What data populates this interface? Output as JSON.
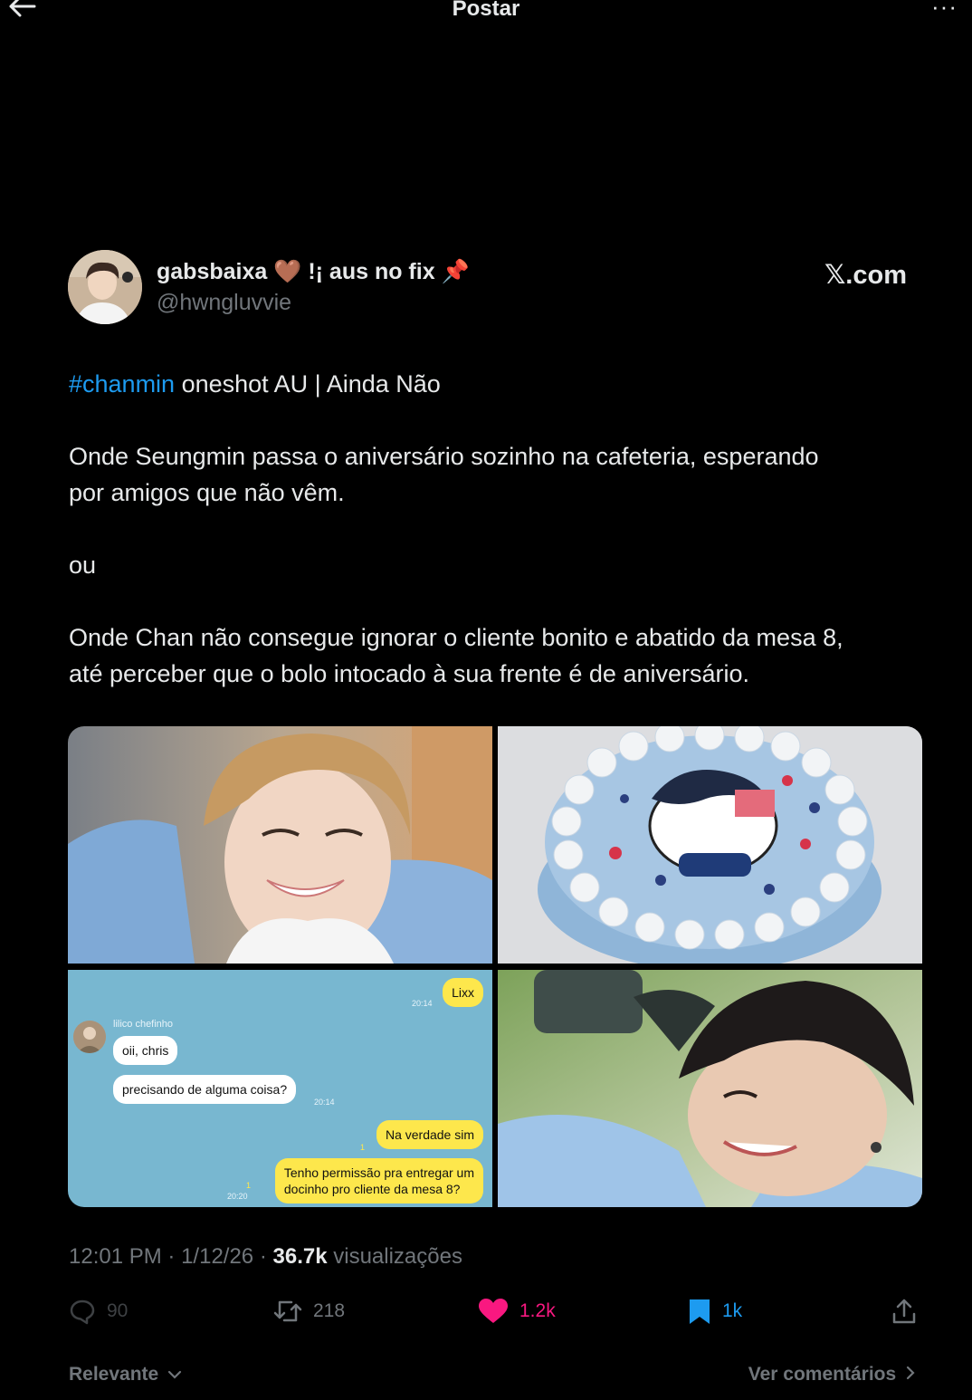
{
  "topbar": {
    "title": "Postar",
    "more_label": "···"
  },
  "author": {
    "display_name": "gabsbaixa",
    "display_heart": "🤎",
    "display_suffix": "!¡ aus no fix",
    "display_pin": "📌",
    "handle": "@hwngluvvie",
    "source": "𝕏.com"
  },
  "post": {
    "hashtag": "#chanmin",
    "title_rest": " oneshot AU | Ainda Não",
    "para1_line1": "Onde Seungmin passa o aniversário sozinho na cafeteria, esperando",
    "para1_line2": "por amigos que não vêm.",
    "para2": "ou",
    "para3_line1": "Onde Chan não consegue ignorar o cliente bonito e abatido da mesa 8,",
    "para3_line2": "até perceber que o bolo intocado à sua frente é de aniversário."
  },
  "chat": {
    "sender_name": "lilico chefinho",
    "messages": [
      {
        "text": "Lixx",
        "side": "right",
        "time": "20:14"
      },
      {
        "text": "oii, chris",
        "side": "left"
      },
      {
        "text": "precisando de alguma coisa?",
        "side": "left",
        "time": "20:14"
      },
      {
        "text": "Na verdade sim",
        "side": "right",
        "read": "1"
      },
      {
        "text": "Tenho permissão pra entregar um",
        "text2": "docinho pro cliente da mesa 8?",
        "side": "right",
        "read": "1",
        "time": "20:20"
      }
    ]
  },
  "meta": {
    "time": "12:01 PM",
    "date": "1/12/26",
    "views_count": "36.7k",
    "views_label": "visualizações"
  },
  "actions": {
    "replies": "90",
    "reposts": "218",
    "likes": "1.2k",
    "bookmarks": "1k"
  },
  "footer": {
    "sort_label": "Relevante",
    "comments_label": "Ver comentários"
  },
  "colors": {
    "background": "#000000",
    "text": "#e7e9ea",
    "muted": "#71767b",
    "link": "#1d9bf0",
    "like": "#f91880",
    "bookmark": "#1d9bf0"
  }
}
